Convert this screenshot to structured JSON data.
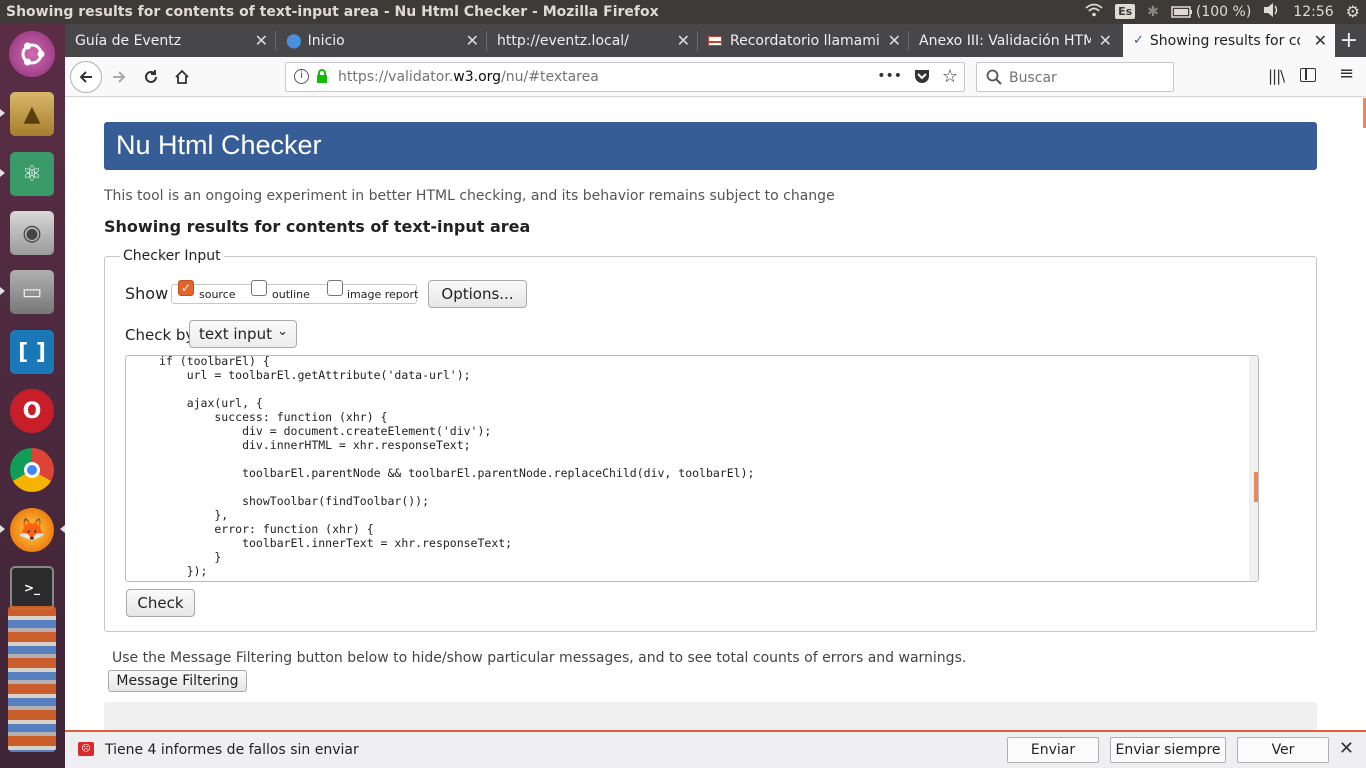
{
  "window": {
    "title": "Showing results for contents of text-input area - Nu Html Checker - Mozilla Firefox",
    "keyboard": "Es",
    "battery": "(100 %)",
    "clock": "12:56"
  },
  "tabs": [
    {
      "label": "Guía de Eventz",
      "active": false
    },
    {
      "label": "Inicio",
      "active": false
    },
    {
      "label": "http://eventz.local/",
      "active": false
    },
    {
      "label": "Recordatorio llamami",
      "active": false
    },
    {
      "label": "Anexo III: Validación HTM",
      "active": false
    },
    {
      "label": "Showing results for co",
      "active": true
    }
  ],
  "address_bar": {
    "url_prefix": "https://validator.",
    "url_domain": "w3.org",
    "url_suffix": "/nu/#textarea",
    "more": "•••"
  },
  "search": {
    "placeholder": "Buscar"
  },
  "page": {
    "header": "Nu Html Checker",
    "tagline": "This tool is an ongoing experiment in better HTML checking, and its behavior remains subject to change",
    "results_heading": "Showing results for contents of text-input area",
    "checker_legend": "Checker Input",
    "show_label": "Show",
    "show_options": [
      {
        "label": "source",
        "checked": true
      },
      {
        "label": "outline",
        "checked": false
      },
      {
        "label": "image report",
        "checked": false
      }
    ],
    "options_button": "Options...",
    "check_by_label": "Check by",
    "check_by_value": "text input",
    "code": "if (toolbarEl) {\n    url = toolbarEl.getAttribute('data-url');\n\n    ajax(url, {\n        success: function (xhr) {\n            div = document.createElement('div');\n            div.innerHTML = xhr.responseText;\n\n            toolbarEl.parentNode && toolbarEl.parentNode.replaceChild(div, toolbarEl);\n\n            showToolbar(findToolbar());\n        },\n        error: function (xhr) {\n            toolbarEl.innerText = xhr.responseText;\n        }\n    });",
    "check_button": "Check",
    "filter_note": "Use the Message Filtering button below to hide/show particular messages, and to see total counts of errors and warnings.",
    "filter_button": "Message Filtering"
  },
  "notification": {
    "message": "Tiene 4 informes de fallos sin enviar",
    "send": "Enviar",
    "always_send": "Enviar siempre",
    "view": "Ver"
  },
  "colors": {
    "header_blue": "#365d95",
    "accent_orange": "#e4652c"
  }
}
